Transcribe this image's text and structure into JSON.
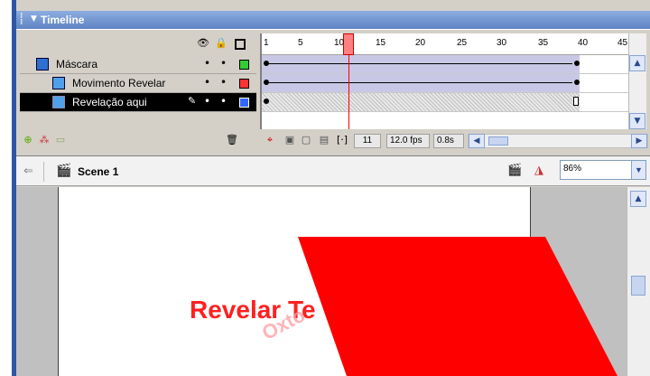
{
  "panel": {
    "title": "Timeline"
  },
  "timeline": {
    "ruler_labels": [
      "1",
      "5",
      "10",
      "15",
      "20",
      "25",
      "30",
      "35",
      "40",
      "45"
    ],
    "current_frame": "11",
    "frame_rate": "12.0 fps",
    "elapsed": "0.8s",
    "layers": [
      {
        "name": "Máscara",
        "color": "#33cc33",
        "type": "mask"
      },
      {
        "name": "Movimento Revelar",
        "color": "#ff3333",
        "type": "masked"
      },
      {
        "name": "Revelação aqui",
        "color": "#3366ff",
        "type": "masked",
        "selected": true
      }
    ]
  },
  "scene": {
    "name": "Scene 1",
    "zoom": "86%"
  },
  "stage": {
    "main_text": "Revelar Te",
    "mirror_text": "Oxto",
    "shape_color": "#ff0000"
  },
  "icons": [
    "eye-icon",
    "lock-icon",
    "outline-icon",
    "add-layer-icon",
    "add-guide-icon",
    "add-folder-icon",
    "trash-icon",
    "back-arrow-icon",
    "scene-icon",
    "edit-symbol-icon",
    "edit-scene-icon"
  ]
}
